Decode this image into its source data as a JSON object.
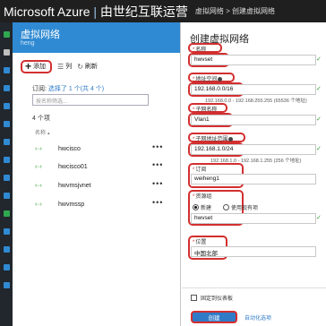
{
  "topbar": {
    "brand_main": "Microsoft Azure",
    "brand_sep": " | ",
    "brand_sub": "由世纪互联运营",
    "breadcrumb": "虚拟网络 > 创建虚拟网络"
  },
  "nav_icons": [
    {
      "icon": "plus-icon",
      "color": "#2fa84f"
    },
    {
      "icon": "list-icon",
      "color": "#bfbfbf"
    },
    {
      "icon": "dashboard-icon",
      "color": "#2f8ad3"
    },
    {
      "icon": "grid-icon",
      "color": "#2f8ad3"
    },
    {
      "icon": "cube-icon",
      "color": "#2f8ad3"
    },
    {
      "icon": "globe-icon",
      "color": "#2f8ad3"
    },
    {
      "icon": "database-icon",
      "color": "#2f8ad3"
    },
    {
      "icon": "clock-icon",
      "color": "#2f8ad3"
    },
    {
      "icon": "vm-icon",
      "color": "#2f8ad3"
    },
    {
      "icon": "cloud-icon",
      "color": "#2f8ad3"
    },
    {
      "icon": "network-icon",
      "color": "#2fa84f"
    },
    {
      "icon": "monitor-icon",
      "color": "#2f8ad3"
    },
    {
      "icon": "storage-icon",
      "color": "#2f8ad3"
    },
    {
      "icon": "web-icon",
      "color": "#2f8ad3"
    },
    {
      "icon": "shield-icon",
      "color": "#2f8ad3"
    }
  ],
  "blade1": {
    "title": "虚拟网络",
    "subtitle": "heng",
    "toolbar": {
      "add_label": "添加",
      "columns_label": "列",
      "refresh_label": "刷新"
    },
    "subscription_label": "订阅:",
    "subscription_value": "选择了 1 个(共 4 个)",
    "filter_placeholder": "按名称筛选...",
    "count": "4 个项",
    "column_header": "名称",
    "items": [
      {
        "name": "hwcisco",
        "more": "•••"
      },
      {
        "name": "hwcisco01",
        "more": "•••"
      },
      {
        "name": "hwvmsjvnet",
        "more": "•••"
      },
      {
        "name": "hwvmssp",
        "more": "•••"
      }
    ]
  },
  "blade2": {
    "title": "创建虚拟网络",
    "fields": {
      "name_label": "名称",
      "name_value": "hwvset",
      "address_label": "地址空间",
      "address_value": "192.168.0.0/16",
      "address_hint": "192.168.0.0 - 192.168.255.255 (65536 个地址)",
      "subnet_label": "子网名称",
      "subnet_value": "Vlan1",
      "subnet_range_label": "子网地址范围",
      "subnet_range_value": "192.168.1.0/24",
      "subnet_range_hint": "192.168.1.0 - 192.168.1.255 (256 个地址)",
      "subscription_label": "订阅",
      "subscription_value": "weiheng1",
      "rg_label": "资源组",
      "rg_new": "新建",
      "rg_existing": "使用现有项",
      "rg_value": "hwvset",
      "location_label": "位置",
      "location_value": "中国北部"
    },
    "pin_label": "固定到仪表板",
    "create_label": "创建",
    "automation_label": "自动化选项"
  },
  "colors": {
    "blade_header": "#2f8ad3",
    "highlight": "#d32f2f",
    "link": "#2f7bc7",
    "valid": "#2e9a2e"
  }
}
